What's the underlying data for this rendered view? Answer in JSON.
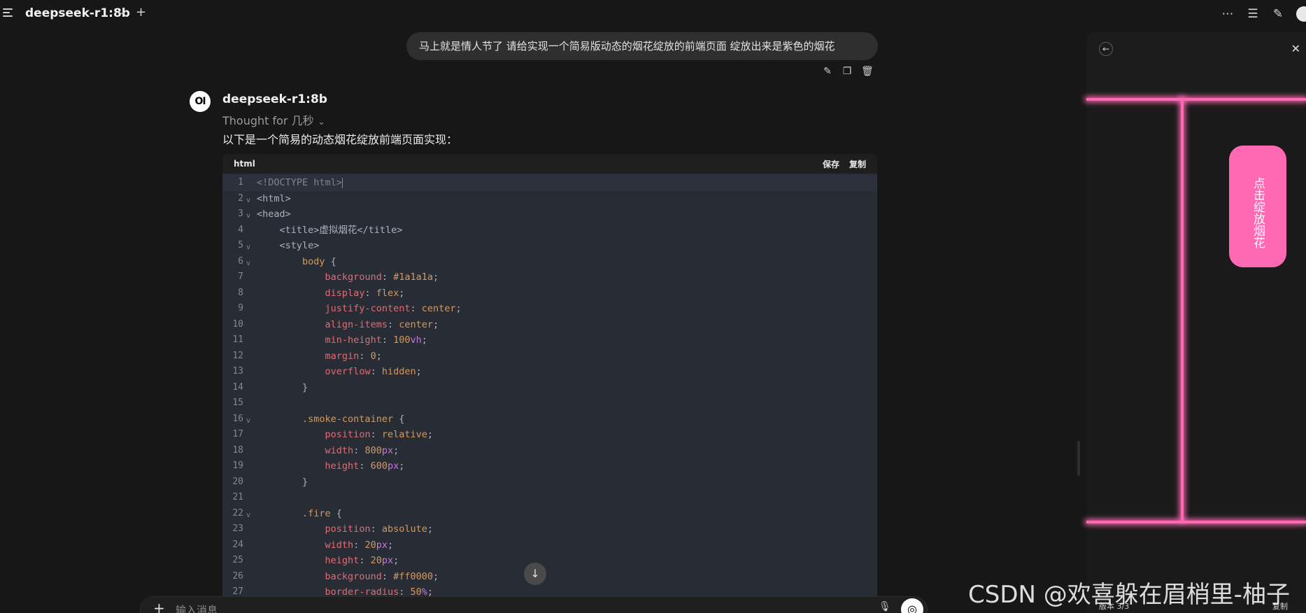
{
  "header": {
    "model_name": "deepseek-r1:8b"
  },
  "user_message": "马上就是情人节了 请给实现一个简易版动态的烟花绽放的前端页面 绽放出来是紫色的烟花",
  "assistant": {
    "avatar_text": "OI",
    "name": "deepseek-r1:8b",
    "thought": "Thought for 几秒",
    "intro": "以下是一个简易的动态烟花绽放前端页面实现："
  },
  "code_block": {
    "language": "html",
    "save_label": "保存",
    "copy_label": "复制",
    "lines": [
      {
        "n": "1",
        "text": "<!DOCTYPE html>"
      },
      {
        "n": "2",
        "text": "<html>"
      },
      {
        "n": "3",
        "text": "<head>"
      },
      {
        "n": "4",
        "text": "    <title>虚拟烟花</title>"
      },
      {
        "n": "5",
        "text": "    <style>"
      },
      {
        "n": "6",
        "text": "        body {"
      },
      {
        "n": "7",
        "text": "            background: #1a1a1a;"
      },
      {
        "n": "8",
        "text": "            display: flex;"
      },
      {
        "n": "9",
        "text": "            justify-content: center;"
      },
      {
        "n": "10",
        "text": "            align-items: center;"
      },
      {
        "n": "11",
        "text": "            min-height: 100vh;"
      },
      {
        "n": "12",
        "text": "            margin: 0;"
      },
      {
        "n": "13",
        "text": "            overflow: hidden;"
      },
      {
        "n": "14",
        "text": "        }"
      },
      {
        "n": "15",
        "text": ""
      },
      {
        "n": "16",
        "text": "        .smoke-container {"
      },
      {
        "n": "17",
        "text": "            position: relative;"
      },
      {
        "n": "18",
        "text": "            width: 800px;"
      },
      {
        "n": "19",
        "text": "            height: 600px;"
      },
      {
        "n": "20",
        "text": "        }"
      },
      {
        "n": "21",
        "text": ""
      },
      {
        "n": "22",
        "text": "        .fire {"
      },
      {
        "n": "23",
        "text": "            position: absolute;"
      },
      {
        "n": "24",
        "text": "            width: 20px;"
      },
      {
        "n": "25",
        "text": "            height: 20px;"
      },
      {
        "n": "26",
        "text": "            background: #ff0000;"
      },
      {
        "n": "27",
        "text": "            border-radius: 50%;"
      }
    ]
  },
  "input": {
    "placeholder": "输入消息"
  },
  "preview": {
    "button_label": "点击绽放烟花",
    "version_label": "版本 3/3",
    "copy_label": "复制",
    "glow_color": "#ff69b4"
  },
  "watermark": "CSDN @欢喜躲在眉梢里-柚子"
}
